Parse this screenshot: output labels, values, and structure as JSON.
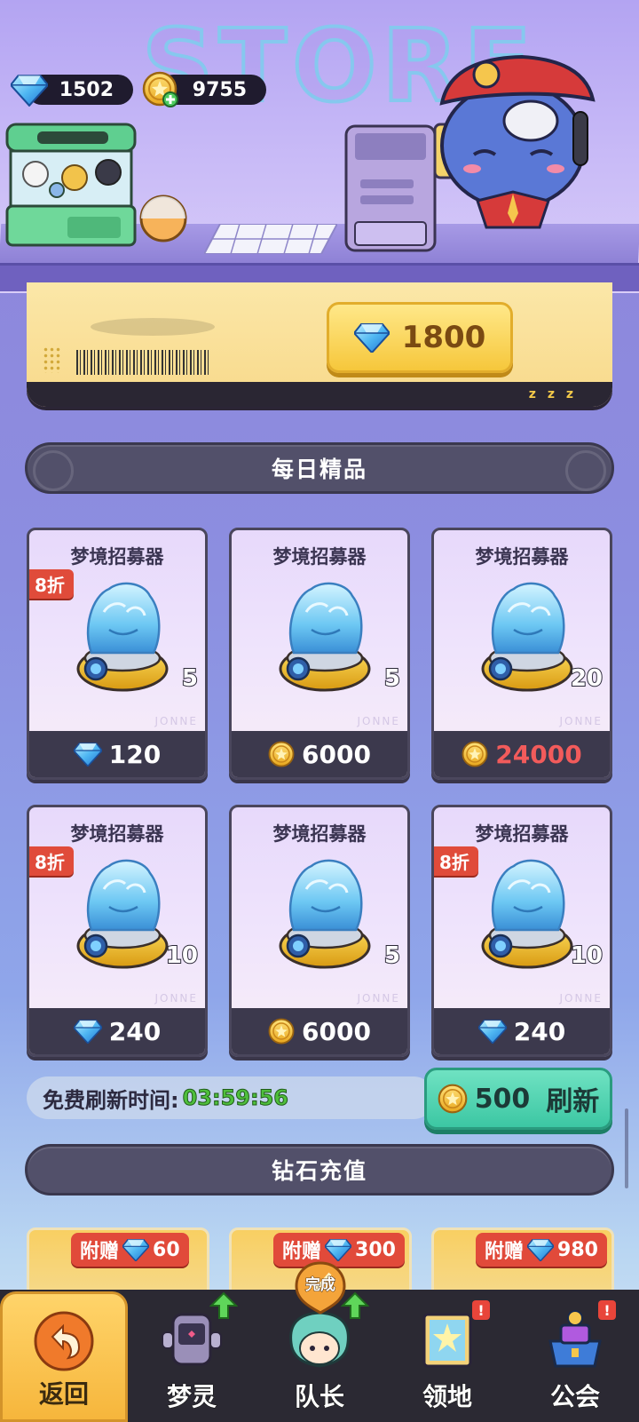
{
  "header": {
    "store_title": "STORE",
    "diamond_count": "1502",
    "coin_count": "9755"
  },
  "featured": {
    "price": "1800",
    "currency_icon": "diamond-icon",
    "ticket_text": "z z z"
  },
  "daily_section": {
    "title": "每日精品",
    "items": [
      {
        "name": "梦境招募器",
        "qty": "5",
        "price": "120",
        "currency": "diamond",
        "discount": "8折",
        "price_color": "#ffffff"
      },
      {
        "name": "梦境招募器",
        "qty": "5",
        "price": "6000",
        "currency": "coin",
        "discount": "",
        "price_color": "#ffffff"
      },
      {
        "name": "梦境招募器",
        "qty": "20",
        "price": "24000",
        "currency": "coin",
        "discount": "",
        "price_color": "#f25b5b"
      },
      {
        "name": "梦境招募器",
        "qty": "10",
        "price": "240",
        "currency": "diamond",
        "discount": "8折",
        "price_color": "#ffffff"
      },
      {
        "name": "梦境招募器",
        "qty": "5",
        "price": "6000",
        "currency": "coin",
        "discount": "",
        "price_color": "#ffffff"
      },
      {
        "name": "梦境招募器",
        "qty": "10",
        "price": "240",
        "currency": "diamond",
        "discount": "8折",
        "price_color": "#ffffff"
      }
    ]
  },
  "refresh": {
    "label": "免费刷新时间:",
    "time": "03:59:56",
    "button_cost": "500",
    "button_label": "刷新"
  },
  "recharge_section": {
    "title": "钻石充值",
    "packs": [
      {
        "bonus_label": "附赠",
        "bonus": "60"
      },
      {
        "bonus_label": "附赠",
        "bonus": "300"
      },
      {
        "bonus_label": "附赠",
        "bonus": "980"
      }
    ]
  },
  "bottom_nav": {
    "items": [
      {
        "label": "返回",
        "icon": "back-arrow-icon",
        "active": true
      },
      {
        "label": "梦灵",
        "icon": "robot-icon",
        "badge": "up-arrow"
      },
      {
        "label": "队长",
        "icon": "captain-avatar-icon",
        "badge": "up-arrow"
      },
      {
        "label": "领地",
        "icon": "territory-icon",
        "badge": "!"
      },
      {
        "label": "公会",
        "icon": "guild-icon",
        "badge": "!"
      }
    ],
    "done_label": "完成"
  },
  "colors": {
    "accent_green": "#3cc7a3",
    "discount_red": "#e04b3a",
    "price_red": "#f25b5b",
    "timer_green": "#4fbf3c"
  }
}
